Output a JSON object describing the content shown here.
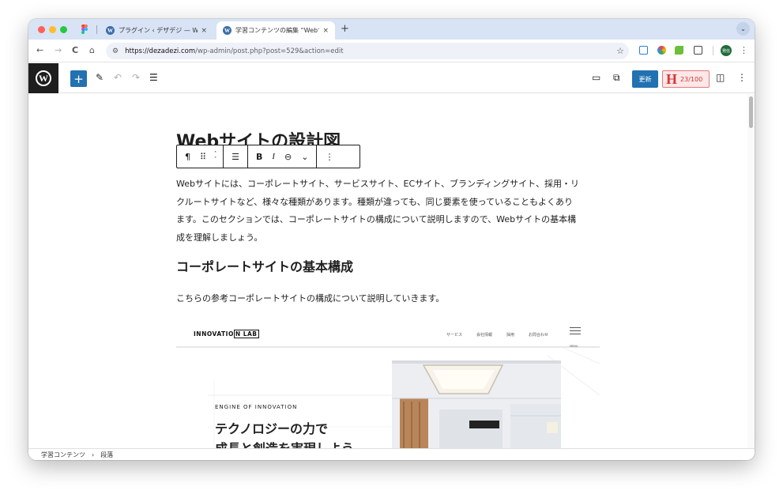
{
  "browser": {
    "tabs": [
      {
        "title": "プラグイン ‹ デザデジ — WordPress",
        "active": false
      },
      {
        "title": "学習コンテンツの編集 “Webサイトの設計図”",
        "active": true
      }
    ],
    "tab_close": "×",
    "new_tab": "+",
    "tabs_menu": "⌄",
    "nav": {
      "back": "←",
      "forward": "→",
      "reload": "C",
      "home": "⌂"
    },
    "url_host": "https://dezadezi.com",
    "url_path": "/wp-admin/post.php?post=529&action=edit",
    "profile_label": "発信"
  },
  "editor": {
    "logo": "W",
    "add": "+",
    "update_label": "更新",
    "score_letter": "H",
    "score": "23/100",
    "post_title": "Webサイトの設計図",
    "block_toolbar": {
      "paragraph": "¶",
      "drag": "⠿",
      "up": "˄",
      "down": "˅",
      "align": "☰",
      "bold": "B",
      "italic": "I",
      "link": "⊖",
      "more_rich": "⌄",
      "options": "⋮"
    },
    "paragraph_lines": [
      "Webサイトには、コーポレートサイト、サービスサイト、ECサイト、ブランディングサイト、採用・リ",
      "クルートサイトなど、様々な種類があります。種類が違っても、同じ要素を使っていることもよくあり",
      "ます。このセクションでは、コーポレートサイトの構成について説明しますので、Webサイトの基本構",
      "成を理解しましょう。"
    ],
    "heading": "コーポレートサイトの基本構成",
    "paragraph2": "こちらの参考コーポレートサイトの構成について説明していきます。"
  },
  "embed": {
    "logo_main": "INNOVATIO",
    "logo_box": "N LAB",
    "nav": [
      "サービス",
      "会社情報",
      "採用",
      "お問合わせ"
    ],
    "menu_label": "MENU",
    "eyebrow": "ENGINE OF INNOVATION",
    "headline_lines": [
      "テクノロジーの力で",
      "成長と創造を実現しよう"
    ]
  },
  "breadcrumb": {
    "items": [
      "学習コンテンツ",
      "段落"
    ],
    "separator": "›"
  },
  "colors": {
    "wp_blue": "#2271b1",
    "score_red": "#d63638",
    "tabstrip": "#d8e3f5"
  }
}
